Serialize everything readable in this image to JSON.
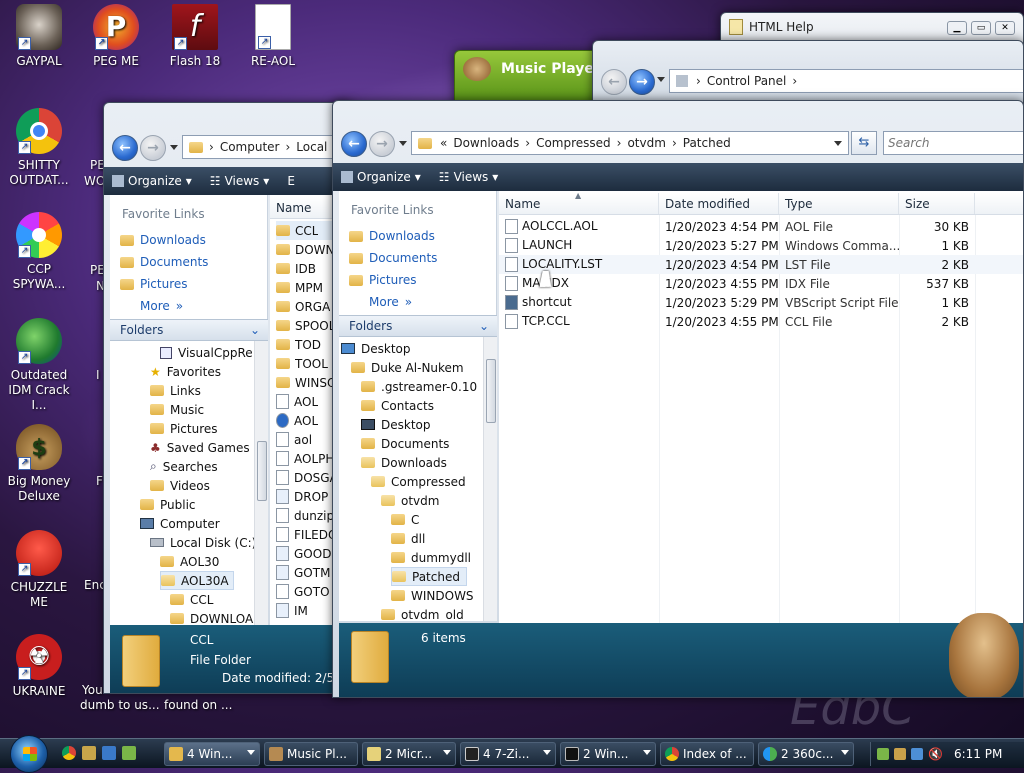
{
  "desktop": {
    "icons": [
      {
        "label": "GAYPAL",
        "icon": "raccoon-icon"
      },
      {
        "label": "PEG ME",
        "icon": "p-logo-icon"
      },
      {
        "label": "Flash 18",
        "icon": "flash-icon"
      },
      {
        "label": "RE-AOL",
        "icon": "blank-file-icon"
      },
      {
        "label": "SHITTY OUTDAT...",
        "icon": "chrome-icon"
      },
      {
        "label": "CCP SPYWA...",
        "icon": "rainbow-circle-icon"
      },
      {
        "label": "Outdated IDM Crack I...",
        "icon": "globe-download-icon"
      },
      {
        "label": "Big Money Deluxe",
        "icon": "money-bag-icon"
      },
      {
        "label": "CHUZZLE ME",
        "icon": "chuzzle-icon"
      },
      {
        "label": "UKRAINE",
        "icon": "radiation-icon"
      }
    ],
    "partial_labels": [
      "PE",
      "WO",
      "PE",
      "N",
      "I",
      "F",
      "Enc",
      "You",
      "dumb to us...",
      "found on ..."
    ],
    "watermark": "EdbC"
  },
  "html_help": {
    "title": "HTML Help"
  },
  "music_player": {
    "title": "Music Player"
  },
  "control_panel": {
    "address": "Control Panel"
  },
  "left_window": {
    "address": [
      "Computer",
      "Local D"
    ],
    "toolbar": {
      "organize": "Organize",
      "views": "Views",
      "extra": "E"
    },
    "favorite_links_header": "Favorite Links",
    "favorites": [
      "Downloads",
      "Documents",
      "Pictures"
    ],
    "more": "More",
    "folders_header": "Folders",
    "tree": [
      "VisualCppRe",
      "Favorites",
      "Links",
      "Music",
      "Pictures",
      "Saved Games",
      "Searches",
      "Videos",
      "Public",
      "Computer",
      "Local Disk (C:)",
      "AOL30",
      "AOL30A",
      "CCL",
      "DOWNLOA"
    ],
    "column_name": "Name",
    "files": [
      "CCL",
      "DOWN",
      "IDB",
      "MPM",
      "ORGA",
      "SPOOL",
      "TOD",
      "TOOL",
      "WINSO",
      "AOL",
      "AOL",
      "aol",
      "AOLPH",
      "DOSGA",
      "DROP",
      "dunzip",
      "FILEDO",
      "GOOD",
      "GOTM",
      "GOTO",
      "IM"
    ],
    "details": {
      "name": "CCL",
      "type": "File Folder",
      "modified": "Date modified: 2/5/2"
    }
  },
  "main_window": {
    "address": [
      "Downloads",
      "Compressed",
      "otvdm",
      "Patched"
    ],
    "search_placeholder": "Search",
    "toolbar": {
      "organize": "Organize",
      "views": "Views"
    },
    "favorite_links_header": "Favorite Links",
    "favorites": [
      "Downloads",
      "Documents",
      "Pictures"
    ],
    "more": "More",
    "folders_header": "Folders",
    "tree": [
      "Desktop",
      "Duke Al-Nukem",
      ".gstreamer-0.10",
      "Contacts",
      "Desktop",
      "Documents",
      "Downloads",
      "Compressed",
      "otvdm",
      "C",
      "dll",
      "dummydll",
      "Patched",
      "WINDOWS",
      "otvdm_old"
    ],
    "columns": {
      "name": "Name",
      "date": "Date modified",
      "type": "Type",
      "size": "Size"
    },
    "files": [
      {
        "name": "AOLCCL.AOL",
        "date": "1/20/2023 4:54 PM",
        "type": "AOL File",
        "size": "30 KB"
      },
      {
        "name": "LAUNCH",
        "date": "1/20/2023 5:27 PM",
        "type": "Windows Comma...",
        "size": "1 KB"
      },
      {
        "name": "LOCALITY.LST",
        "date": "1/20/2023 4:54 PM",
        "type": "LST File",
        "size": "2 KB"
      },
      {
        "name": "MAI.IDX",
        "date": "1/20/2023 4:55 PM",
        "type": "IDX File",
        "size": "537 KB"
      },
      {
        "name": "shortcut",
        "date": "1/20/2023 5:29 PM",
        "type": "VBScript Script File",
        "size": "1 KB"
      },
      {
        "name": "TCP.CCL",
        "date": "1/20/2023 4:55 PM",
        "type": "CCL File",
        "size": "2 KB"
      }
    ],
    "details": {
      "count": "6 items"
    }
  },
  "taskbar": {
    "tasks": [
      "4 Win...",
      "Music Pl...",
      "2 Micr...",
      "4 7-Zi...",
      "2 Win...",
      "Index of ...",
      "2 360c..."
    ],
    "clock": "6:11 PM"
  }
}
